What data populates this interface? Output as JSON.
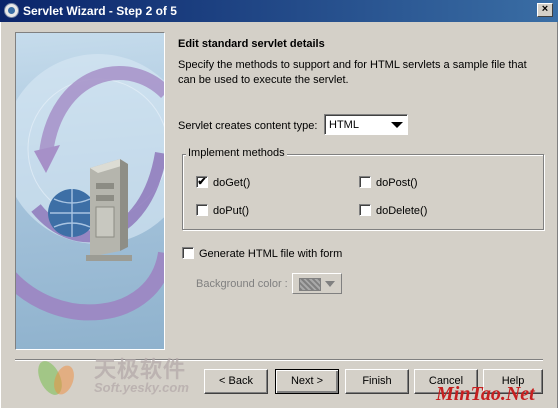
{
  "window": {
    "title": "Servlet Wizard - Step 2 of 5",
    "close_glyph": "×"
  },
  "content": {
    "heading": "Edit standard servlet details",
    "description": "Specify the methods to support and for HTML servlets a sample file that can be used to execute the servlet.",
    "content_type_label": "Servlet creates content type:",
    "content_type_value": "HTML"
  },
  "implement_methods": {
    "legend": "Implement methods",
    "methods": [
      {
        "label": "doGet()",
        "checked": true,
        "check_glyph": "✔"
      },
      {
        "label": "doPost()",
        "checked": false
      },
      {
        "label": "doPut()",
        "checked": false
      },
      {
        "label": "doDelete()",
        "checked": false
      }
    ]
  },
  "generate_html": {
    "label": "Generate HTML file with form",
    "checked": false,
    "background_color_label": "Background color :"
  },
  "buttons": {
    "back": "< Back",
    "next": "Next >",
    "finish": "Finish",
    "cancel": "Cancel",
    "help": "Help"
  },
  "watermarks": {
    "left_cn": "天极软件",
    "left_en": "Soft.yesky.com",
    "right": "MinTao.Net"
  },
  "icons": {
    "window_icon": "app-icon",
    "side_image": "server-globe-illustration"
  },
  "colors": {
    "titlebar_start": "#0a246a",
    "titlebar_end": "#3a6ea5",
    "window_bg": "#d4d0c8",
    "watermark_red": "#c62020"
  }
}
